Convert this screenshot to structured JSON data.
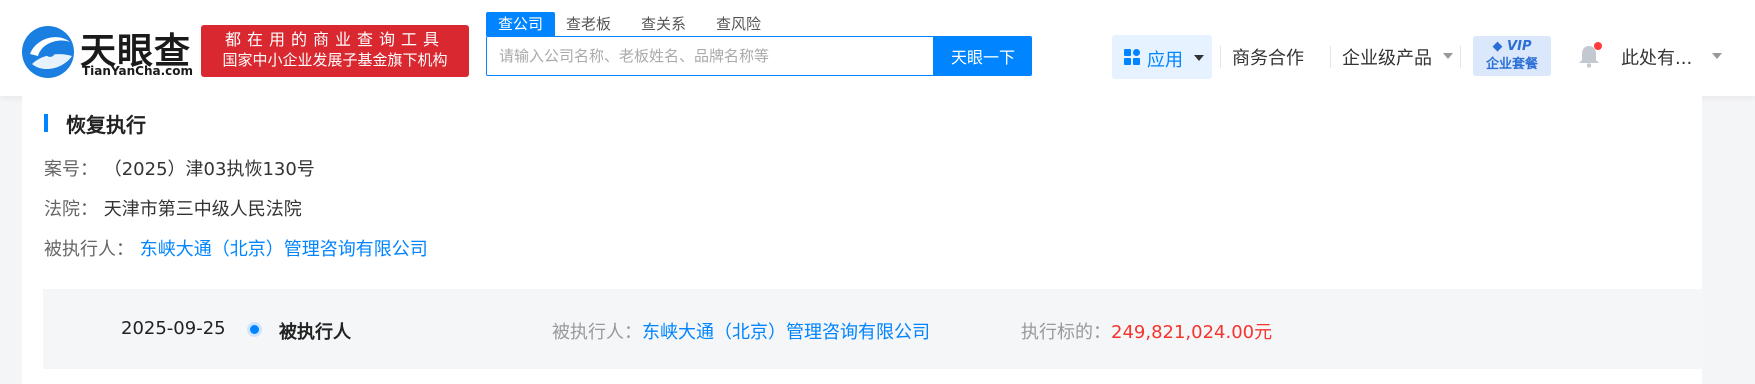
{
  "header": {
    "logo": {
      "name": "天眼查",
      "domain": "TianYanCha.com",
      "icon": "tianyancha-logo-icon"
    },
    "slogan": {
      "line1": "都在用的商业查询工具",
      "line2": "国家中小企业发展子基金旗下机构"
    },
    "search": {
      "tabs": [
        "查公司",
        "查老板",
        "查关系",
        "查风险"
      ],
      "active_tab": "查公司",
      "placeholder": "请输入公司名称、老板姓名、品牌名称等",
      "value": "",
      "button_label": "天眼一下"
    },
    "nav": {
      "apps_label": "应用",
      "business_label": "商务合作",
      "enterprise_label": "企业级产品",
      "vip_top": "VIP",
      "vip_bottom": "企业套餐",
      "user_label": "此处有...",
      "bell_icon": "bell-icon"
    }
  },
  "section": {
    "title": "恢复执行",
    "case_no_label": "案号：",
    "case_no": "（2025）津03执恢130号",
    "court_label": "法院：",
    "court": "天津市第三中级人民法院",
    "executee_label": "被执行人：",
    "executee": "东峡大通（北京）管理咨询有限公司"
  },
  "record": {
    "date": "2025-09-25",
    "role": "被执行人",
    "party_label": "被执行人：",
    "party": "东峡大通（北京）管理咨询有限公司",
    "amount_label": "执行标的：",
    "amount": "249,821,024.00元"
  },
  "colors": {
    "accent": "#0084ff",
    "slogan_bg": "#d9282f",
    "amount": "#f5352d"
  }
}
